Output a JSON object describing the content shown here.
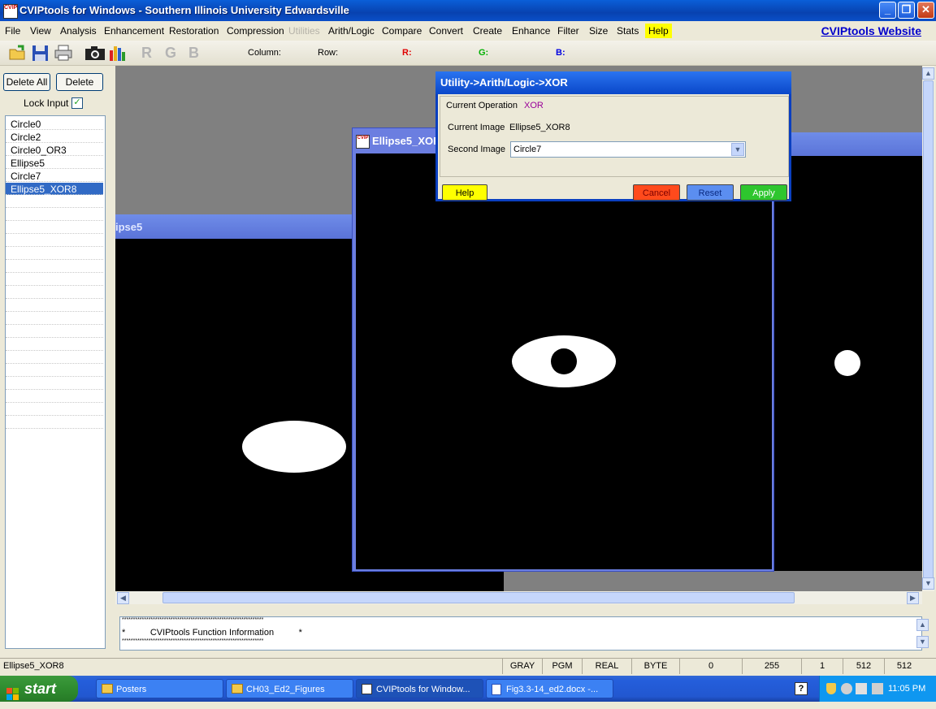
{
  "window": {
    "title": "CVIPtools for Windows - Southern Illinois University Edwardsville",
    "icon_text": "CVIP",
    "controls": [
      "minimize-icon",
      "restore-icon",
      "close-icon"
    ]
  },
  "menubar": {
    "items": [
      {
        "label": "File",
        "state": "enabled"
      },
      {
        "label": "View",
        "state": "enabled"
      },
      {
        "label": "Analysis",
        "state": "enabled"
      },
      {
        "label": "Enhancement",
        "state": "enabled"
      },
      {
        "label": "Restoration",
        "state": "enabled"
      },
      {
        "label": "Compression",
        "state": "enabled"
      },
      {
        "label": "Utilities",
        "state": "disabled"
      },
      {
        "label": "Arith/Logic",
        "state": "enabled"
      },
      {
        "label": "Compare",
        "state": "enabled"
      },
      {
        "label": "Convert",
        "state": "enabled"
      },
      {
        "label": "Create",
        "state": "enabled"
      },
      {
        "label": "Enhance",
        "state": "enabled"
      },
      {
        "label": "Filter",
        "state": "enabled"
      },
      {
        "label": "Size",
        "state": "enabled"
      },
      {
        "label": "Stats",
        "state": "enabled"
      },
      {
        "label": "Help",
        "state": "highlighted"
      }
    ],
    "website_link": "CVIPtools Website"
  },
  "toolbar": {
    "icons": [
      "open-folder-icon",
      "save-disk-icon",
      "print-icon",
      "camera-icon",
      "histogram-icon"
    ],
    "channel_letters": [
      "R",
      "G",
      "B"
    ],
    "column_label": "Column:",
    "row_label": "Row:",
    "r_label": "R:",
    "g_label": "G:",
    "b_label": "B:",
    "r_color": "#e00000",
    "g_color": "#00b000",
    "b_color": "#0000e0"
  },
  "left_panel": {
    "delete_all_label": "Delete All",
    "delete_label": "Delete",
    "lock_input_label": "Lock Input",
    "lock_input_checked": true,
    "images": [
      {
        "name": "Circle0",
        "selected": false
      },
      {
        "name": "Circle2",
        "selected": false
      },
      {
        "name": "Circle0_OR3",
        "selected": false
      },
      {
        "name": "Ellipse5",
        "selected": false
      },
      {
        "name": "Circle7",
        "selected": false
      },
      {
        "name": "Ellipse5_XOR8",
        "selected": true
      }
    ]
  },
  "image_windows": [
    {
      "title": "ipse5"
    },
    {
      "title": "Ellipse5_XOR"
    },
    {
      "title": ""
    }
  ],
  "dialog": {
    "title": "Utility->Arith/Logic->XOR",
    "current_operation_label": "Current Operation",
    "current_operation_value": "XOR",
    "current_image_label": "Current Image",
    "current_image_value": "Ellipse5_XOR8",
    "second_image_label": "Second Image",
    "second_image_value": "Circle7",
    "help_label": "Help",
    "cancel_label": "Cancel",
    "reset_label": "Reset",
    "apply_label": "Apply",
    "colors": {
      "help": "#ffff00",
      "cancel": "#ff4a1c",
      "reset": "#5b8ef0",
      "apply": "#2ec62e",
      "operation_value": "#990099"
    }
  },
  "info_panel": {
    "border_line": "****************************************************************",
    "message": "*          CVIPtools Function Information          *"
  },
  "status_bar": {
    "image_name": "Ellipse5_XOR8",
    "cells": [
      "GRAY",
      "PGM",
      "REAL",
      "BYTE",
      "0",
      "255",
      "1",
      "512",
      "512"
    ]
  },
  "taskbar": {
    "start_label": "start",
    "tasks": [
      {
        "label": "Posters",
        "icon": "folder-icon",
        "active": false
      },
      {
        "label": "CH03_Ed2_Figures",
        "icon": "folder-icon",
        "active": false
      },
      {
        "label": "CVIPtools for Window...",
        "icon": "cviptools-icon",
        "active": true
      },
      {
        "label": "Fig3.3-14_ed2.docx -...",
        "icon": "word-doc-icon",
        "active": false
      }
    ],
    "help_icon_text": "?",
    "clock": "11:05 PM"
  }
}
